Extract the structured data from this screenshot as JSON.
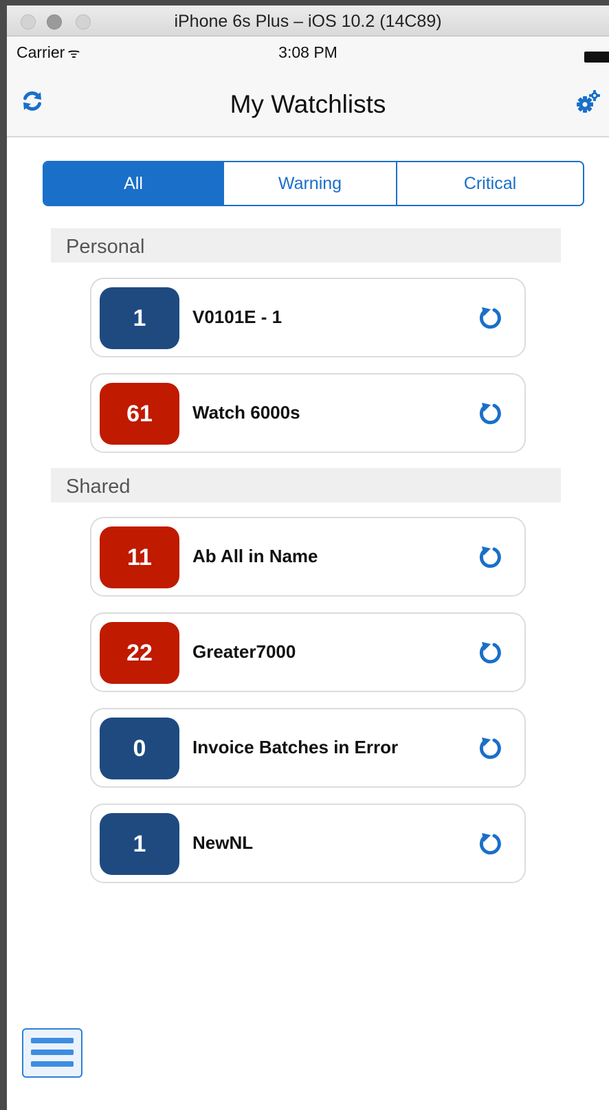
{
  "window": {
    "title": "iPhone 6s Plus – iOS 10.2 (14C89)"
  },
  "status_bar": {
    "carrier": "Carrier",
    "wifi_glyph": "ᯤ",
    "time": "3:08 PM"
  },
  "nav": {
    "title": "My Watchlists",
    "left_icon": "refresh-icon",
    "right_icon": "gears-icon"
  },
  "filter": {
    "segments": [
      "All",
      "Warning",
      "Critical"
    ],
    "selected": "All"
  },
  "colors": {
    "accent": "#1a6fc9",
    "normal_badge": "#1e4a80",
    "alert_badge": "#c01a00"
  },
  "sections": [
    {
      "title": "Personal",
      "items": [
        {
          "count": "1",
          "name": "V0101E - 1",
          "status": "normal"
        },
        {
          "count": "61",
          "name": "Watch 6000s",
          "status": "alert"
        }
      ]
    },
    {
      "title": "Shared",
      "items": [
        {
          "count": "11",
          "name": "Ab All in Name",
          "status": "alert"
        },
        {
          "count": "22",
          "name": "Greater7000",
          "status": "alert"
        },
        {
          "count": "0",
          "name": "Invoice Batches in Error",
          "status": "normal"
        },
        {
          "count": "1",
          "name": "NewNL",
          "status": "normal"
        }
      ]
    }
  ],
  "footer": {
    "menu_icon": "hamburger-menu-icon"
  }
}
